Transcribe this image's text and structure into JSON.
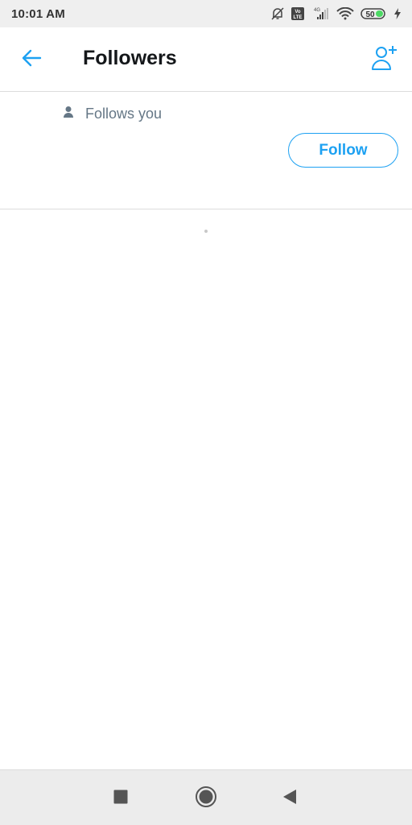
{
  "status_bar": {
    "time": "10:01 AM",
    "icons": [
      "mute-bell-icon",
      "volte-icon",
      "signal-4g-icon",
      "wifi-icon",
      "battery-icon",
      "charging-icon"
    ],
    "battery_level": "50",
    "network_label": "4G",
    "volte_label": "Vo LTE"
  },
  "app_bar": {
    "title": "Followers",
    "back_icon": "arrow-left-icon",
    "action_icon": "add-user-icon"
  },
  "followers": [
    {
      "badge_text": "Follows you",
      "badge_icon": "person-icon",
      "follow_label": "Follow"
    }
  ],
  "nav_bar": {
    "buttons": [
      "recents-icon",
      "home-icon",
      "back-icon"
    ]
  },
  "colors": {
    "accent": "#1da1f2",
    "title_text": "#14171a",
    "secondary_text": "#657786",
    "battery_fill": "#4cd964"
  }
}
